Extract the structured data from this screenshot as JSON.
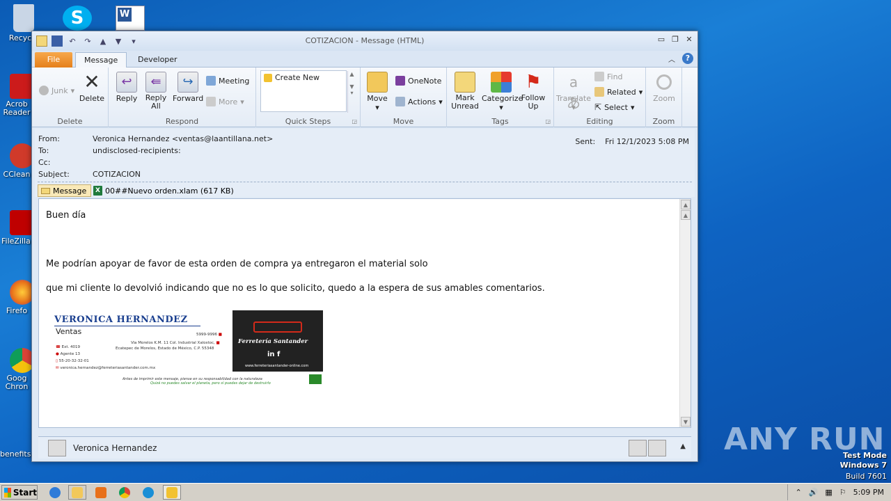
{
  "desktop": {
    "icons": [
      {
        "label": "Recycle",
        "name": "recycle-bin-icon",
        "color": "#c9d6e6"
      },
      {
        "label": "Acrob Reader",
        "name": "acrobat-reader-icon",
        "color": "#cc1b1b"
      },
      {
        "label": "CClean",
        "name": "ccleaner-icon",
        "color": "#d03a2a"
      },
      {
        "label": "FileZilla C",
        "name": "filezilla-icon",
        "color": "#bf0000"
      },
      {
        "label": "Firefo",
        "name": "firefox-icon",
        "color": "#e8701a"
      },
      {
        "label": "Goog Chron",
        "name": "chrome-icon",
        "color": "#2a8a3a"
      },
      {
        "label": "benefits",
        "name": "benefits-file-icon",
        "color": "#ffffff"
      }
    ]
  },
  "window": {
    "title": "COTIZACION - Message (HTML)",
    "tabs": {
      "file": "File",
      "message": "Message",
      "developer": "Developer"
    },
    "ribbon": {
      "delete_group": {
        "label": "Delete",
        "junk": "Junk",
        "delete": "Delete"
      },
      "respond_group": {
        "label": "Respond",
        "reply": "Reply",
        "reply_all": "Reply All",
        "forward": "Forward",
        "meeting": "Meeting",
        "more": "More"
      },
      "quicksteps_group": {
        "label": "Quick Steps",
        "create_new": "Create New"
      },
      "move_group": {
        "label": "Move",
        "move": "Move",
        "onenote": "OneNote",
        "actions": "Actions"
      },
      "tags_group": {
        "label": "Tags",
        "mark_unread": "Mark Unread",
        "categorize": "Categorize",
        "follow_up": "Follow Up"
      },
      "editing_group": {
        "label": "Editing",
        "translate": "Translate",
        "find": "Find",
        "related": "Related",
        "select": "Select"
      },
      "zoom_group": {
        "label": "Zoom",
        "zoom": "Zoom"
      }
    },
    "header": {
      "from_label": "From:",
      "from_value": "Veronica Hernandez <ventas@laantillana.net>",
      "to_label": "To:",
      "to_value": "undisclosed-recipients:",
      "cc_label": "Cc:",
      "cc_value": "",
      "subject_label": "Subject:",
      "subject_value": "COTIZACION",
      "sent_label": "Sent:",
      "sent_value": "Fri 12/1/2023 5:08 PM",
      "message_tab": "Message",
      "attachment": "00##Nuevo orden.xlam (617 KB)"
    },
    "body": {
      "greeting": "Buen día",
      "line1": "Me podrían apoyar de favor de esta orden de compra ya entregaron el material solo",
      "line2": "que mi cliente lo devolvió indicando que no es lo que solicito, quedo a la espera de sus amables comentarios."
    },
    "signature": {
      "name": "VERONICA HERNANDEZ",
      "role": "Ventas",
      "ext": "Ext. 4019",
      "agent": "Agente 13",
      "mobile": "55-20-32-32-01",
      "email": "veronica.hernandez@ferreteriasantander.com.mx",
      "phone": "5999-9996",
      "address1": "Via Morelos K.M. 11 Col. Industrial Xalostoc,",
      "address2": "Ecatepec de Morelos, Estado de México, C.P. 55348",
      "company": "Ferretería Santander",
      "social": "in   f",
      "url": "www.ferreteriasantander-online.com",
      "footer1": "Antes de imprimir este mensaje, piense en su responsabilidad con la naturaleza",
      "footer2": "Quizá no puedes salvar el planeta, pero sí puedes dejar de destruirlo"
    },
    "people_pane": {
      "name": "Veronica Hernandez"
    }
  },
  "taskbar": {
    "start": "Start",
    "clock": "5:09 PM"
  },
  "watermark": {
    "brand": "ANY RUN",
    "mode": "Test Mode",
    "os": "Windows 7",
    "build": "Build 7601"
  }
}
